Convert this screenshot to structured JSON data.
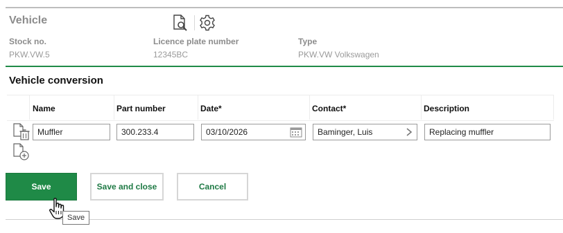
{
  "vehicle": {
    "title": "Vehicle",
    "fields": [
      {
        "label": "Stock no.",
        "value": "PKW.VW.5"
      },
      {
        "label": "Licence plate number",
        "value": "12345BC"
      },
      {
        "label": "Type",
        "value": "PKW.VW Volkswagen"
      }
    ]
  },
  "conversion": {
    "title": "Vehicle conversion",
    "columns": [
      "Name",
      "Part number",
      "Date*",
      "Contact*",
      "Description"
    ],
    "row": {
      "name": "Muffler",
      "part_number": "300.233.4",
      "date": "03/10/2026",
      "contact": "Baminger, Luis",
      "description": "Replacing muffler"
    }
  },
  "actions": {
    "save": "Save",
    "save_and_close": "Save and close",
    "cancel": "Cancel"
  },
  "tooltip": "Save",
  "colors": {
    "accent": "#1f8a47",
    "muted_text": "#8c8c8c"
  },
  "icons": [
    "document-search-icon",
    "gear-icon",
    "document-delete-icon",
    "document-add-icon",
    "calendar-icon",
    "chevron-right-icon",
    "hand-cursor-icon"
  ]
}
